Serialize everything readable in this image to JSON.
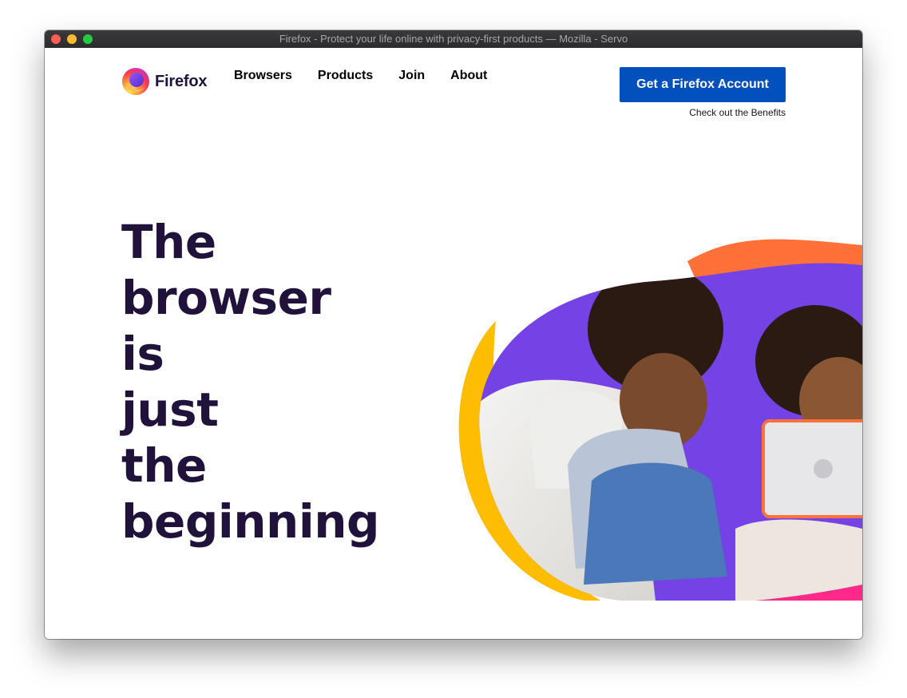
{
  "window": {
    "title": "Firefox - Protect your life online with privacy-first products — Mozilla - Servo"
  },
  "brand": {
    "name": "Firefox",
    "logo_icon": "firefox-logo-icon"
  },
  "nav": {
    "items": [
      {
        "label": "Browsers"
      },
      {
        "label": "Products"
      },
      {
        "label": "Join"
      },
      {
        "label": "About"
      }
    ]
  },
  "cta": {
    "button_label": "Get a Firefox Account",
    "sub_link": "Check out the Benefits"
  },
  "hero": {
    "lines": [
      "The",
      "browser",
      "is",
      "just",
      "the",
      "beginning"
    ]
  },
  "colors": {
    "accent_blue": "#0250bb",
    "heading": "#20123a",
    "purple": "#7542e5",
    "orange": "#ff7139",
    "yellow": "#ffbd00",
    "pink": "#ff298a"
  }
}
